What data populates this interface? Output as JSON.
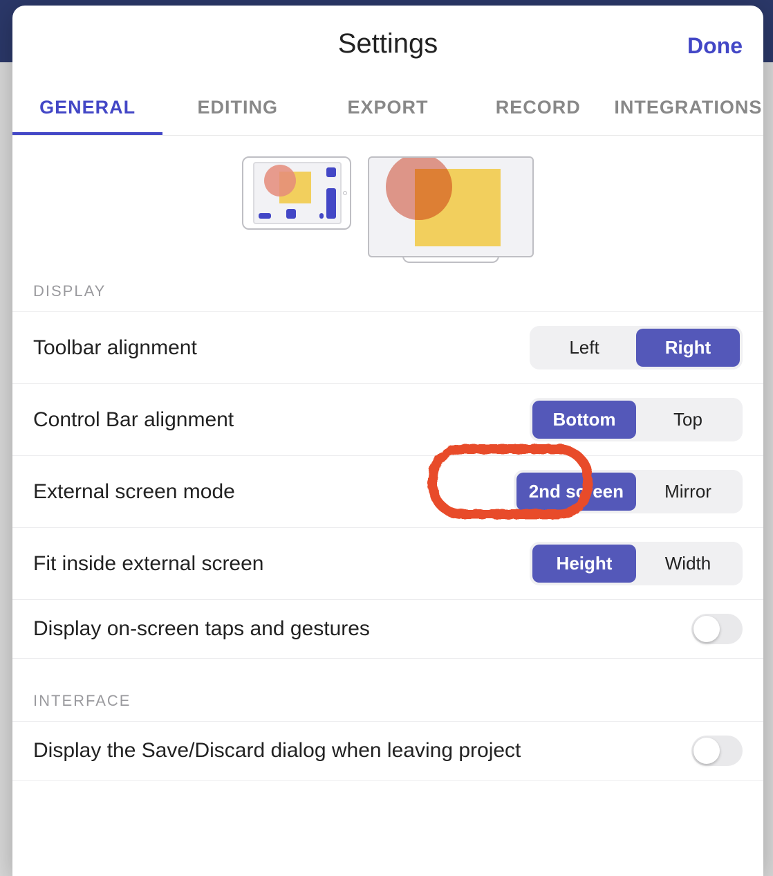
{
  "header": {
    "title": "Settings",
    "done": "Done"
  },
  "tabs": [
    "GENERAL",
    "EDITING",
    "EXPORT",
    "RECORD",
    "INTEGRATIONS"
  ],
  "activeTab": 0,
  "sections": {
    "display": {
      "label": "DISPLAY",
      "rows": {
        "toolbar": {
          "label": "Toolbar alignment",
          "options": [
            "Left",
            "Right"
          ],
          "selected": 1
        },
        "controlbar": {
          "label": "Control Bar alignment",
          "options": [
            "Bottom",
            "Top"
          ],
          "selected": 0
        },
        "external": {
          "label": "External screen mode",
          "options": [
            "2nd screen",
            "Mirror"
          ],
          "selected": 0,
          "highlighted": true
        },
        "fit": {
          "label": "Fit inside external screen",
          "options": [
            "Height",
            "Width"
          ],
          "selected": 0
        },
        "taps": {
          "label": "Display on-screen taps and gestures",
          "on": false
        }
      }
    },
    "interface": {
      "label": "INTERFACE",
      "rows": {
        "savediscard": {
          "label": "Display the Save/Discard dialog when leaving project",
          "on": false
        }
      }
    }
  },
  "colors": {
    "accent": "#4347c6",
    "highlight": "#e84b2a"
  }
}
